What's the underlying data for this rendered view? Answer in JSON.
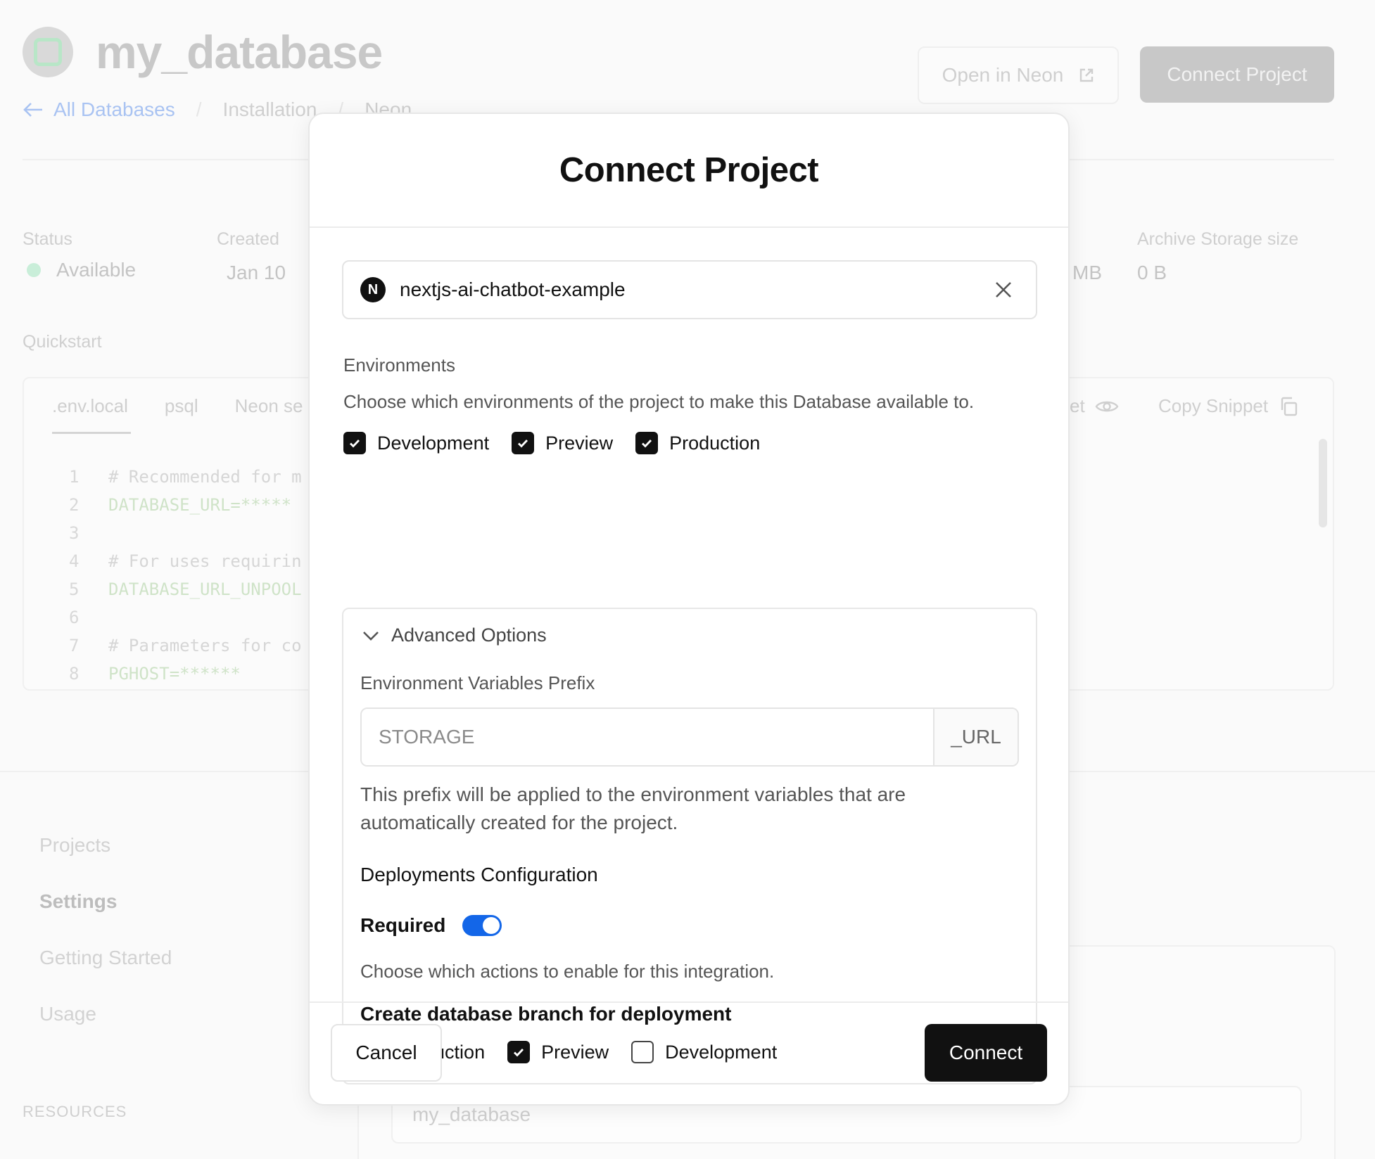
{
  "background": {
    "database_name": "my_database",
    "open_in_neon_label": "Open in Neon",
    "connect_project_label": "Connect Project",
    "breadcrumbs": {
      "back_label": "All Databases",
      "items": [
        "Installation",
        "Neon"
      ]
    },
    "stats": {
      "status_label": "Status",
      "status_value": "Available",
      "created_label": "Created",
      "created_value": "Jan 10",
      "partial_value": "MB",
      "archive_label": "Archive Storage size",
      "archive_value": "0 B"
    },
    "quickstart": {
      "title": "Quickstart",
      "tabs": [
        ".env.local",
        "psql",
        "Neon se"
      ],
      "show_secret_partial": "et",
      "copy_snippet_label": "Copy Snippet",
      "code_lines": [
        {
          "num": "1",
          "text": "# Recommended for m",
          "kind": "comment"
        },
        {
          "num": "2",
          "text": "DATABASE_URL=*****",
          "kind": "green"
        },
        {
          "num": "3",
          "text": "",
          "kind": "comment"
        },
        {
          "num": "4",
          "text": "# For uses requirin",
          "kind": "comment"
        },
        {
          "num": "5",
          "text": "DATABASE_URL_UNPOOL",
          "kind": "green"
        },
        {
          "num": "6",
          "text": "",
          "kind": "comment"
        },
        {
          "num": "7",
          "text": "# Parameters for co",
          "kind": "comment"
        },
        {
          "num": "8",
          "text": "PGHOST=******",
          "kind": "green"
        }
      ]
    },
    "sidebar": {
      "items": [
        "Projects",
        "Settings",
        "Getting Started",
        "Usage"
      ],
      "resources_label": "RESOURCES"
    },
    "bottom_input_value": "my_database",
    "colors": {
      "status_dot": "#c9eed9",
      "back_link": "#a9c3f2"
    }
  },
  "modal": {
    "title": "Connect Project",
    "project": {
      "icon": "nextjs-logo-icon",
      "icon_letter": "N",
      "name": "nextjs-ai-chatbot-example"
    },
    "environments": {
      "label": "Environments",
      "description": "Choose which environments of the project to make this Database available to.",
      "options": [
        {
          "label": "Development",
          "checked": true
        },
        {
          "label": "Preview",
          "checked": true
        },
        {
          "label": "Production",
          "checked": true
        }
      ]
    },
    "advanced": {
      "toggle_label": "Advanced Options",
      "prefix_label": "Environment Variables Prefix",
      "prefix_placeholder": "STORAGE",
      "prefix_value": "",
      "prefix_suffix": "_URL",
      "prefix_help_line1": "This prefix will be applied to the environment variables that are",
      "prefix_help_line2": "automatically created for the project.",
      "deployments_heading": "Deployments Configuration",
      "required_label": "Required",
      "required_on": true,
      "actions_description": "Choose which actions to enable for this integration.",
      "branch_heading": "Create database branch for deployment",
      "branch_options": [
        {
          "label": "Production",
          "checked": false
        },
        {
          "label": "Preview",
          "checked": true
        },
        {
          "label": "Development",
          "checked": false
        }
      ]
    },
    "footer": {
      "cancel_label": "Cancel",
      "connect_label": "Connect"
    },
    "colors": {
      "accent_toggle": "#1366e8",
      "primary_button": "#111111"
    }
  }
}
